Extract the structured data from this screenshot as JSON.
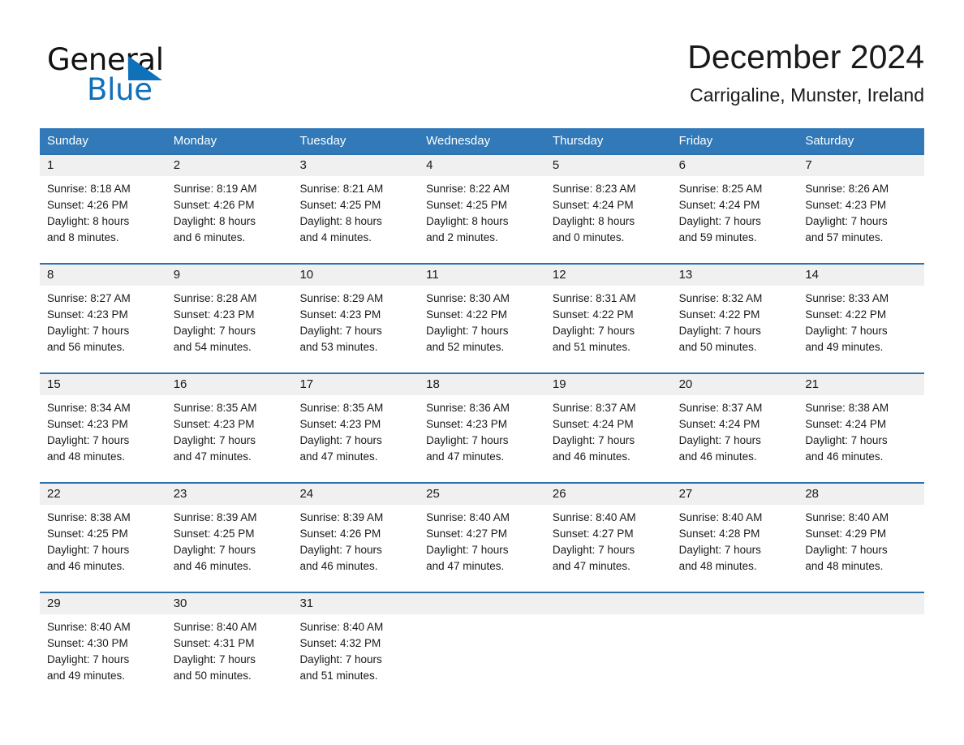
{
  "brand": {
    "name_top": "General",
    "name_bottom": "Blue",
    "color_black": "#111111",
    "color_blue": "#1071bb"
  },
  "header": {
    "month_title": "December 2024",
    "location": "Carrigaline, Munster, Ireland"
  },
  "theme": {
    "header_blue": "#3179b8",
    "separator_blue": "#2e72ac",
    "date_band_gray": "#f0f0f0",
    "text_dark": "#1a1a1a"
  },
  "weekday_headers": [
    "Sunday",
    "Monday",
    "Tuesday",
    "Wednesday",
    "Thursday",
    "Friday",
    "Saturday"
  ],
  "weeks": [
    [
      {
        "day": "1",
        "sunrise": "Sunrise: 8:18 AM",
        "sunset": "Sunset: 4:26 PM",
        "daylight1": "Daylight: 8 hours",
        "daylight2": "and 8 minutes."
      },
      {
        "day": "2",
        "sunrise": "Sunrise: 8:19 AM",
        "sunset": "Sunset: 4:26 PM",
        "daylight1": "Daylight: 8 hours",
        "daylight2": "and 6 minutes."
      },
      {
        "day": "3",
        "sunrise": "Sunrise: 8:21 AM",
        "sunset": "Sunset: 4:25 PM",
        "daylight1": "Daylight: 8 hours",
        "daylight2": "and 4 minutes."
      },
      {
        "day": "4",
        "sunrise": "Sunrise: 8:22 AM",
        "sunset": "Sunset: 4:25 PM",
        "daylight1": "Daylight: 8 hours",
        "daylight2": "and 2 minutes."
      },
      {
        "day": "5",
        "sunrise": "Sunrise: 8:23 AM",
        "sunset": "Sunset: 4:24 PM",
        "daylight1": "Daylight: 8 hours",
        "daylight2": "and 0 minutes."
      },
      {
        "day": "6",
        "sunrise": "Sunrise: 8:25 AM",
        "sunset": "Sunset: 4:24 PM",
        "daylight1": "Daylight: 7 hours",
        "daylight2": "and 59 minutes."
      },
      {
        "day": "7",
        "sunrise": "Sunrise: 8:26 AM",
        "sunset": "Sunset: 4:23 PM",
        "daylight1": "Daylight: 7 hours",
        "daylight2": "and 57 minutes."
      }
    ],
    [
      {
        "day": "8",
        "sunrise": "Sunrise: 8:27 AM",
        "sunset": "Sunset: 4:23 PM",
        "daylight1": "Daylight: 7 hours",
        "daylight2": "and 56 minutes."
      },
      {
        "day": "9",
        "sunrise": "Sunrise: 8:28 AM",
        "sunset": "Sunset: 4:23 PM",
        "daylight1": "Daylight: 7 hours",
        "daylight2": "and 54 minutes."
      },
      {
        "day": "10",
        "sunrise": "Sunrise: 8:29 AM",
        "sunset": "Sunset: 4:23 PM",
        "daylight1": "Daylight: 7 hours",
        "daylight2": "and 53 minutes."
      },
      {
        "day": "11",
        "sunrise": "Sunrise: 8:30 AM",
        "sunset": "Sunset: 4:22 PM",
        "daylight1": "Daylight: 7 hours",
        "daylight2": "and 52 minutes."
      },
      {
        "day": "12",
        "sunrise": "Sunrise: 8:31 AM",
        "sunset": "Sunset: 4:22 PM",
        "daylight1": "Daylight: 7 hours",
        "daylight2": "and 51 minutes."
      },
      {
        "day": "13",
        "sunrise": "Sunrise: 8:32 AM",
        "sunset": "Sunset: 4:22 PM",
        "daylight1": "Daylight: 7 hours",
        "daylight2": "and 50 minutes."
      },
      {
        "day": "14",
        "sunrise": "Sunrise: 8:33 AM",
        "sunset": "Sunset: 4:22 PM",
        "daylight1": "Daylight: 7 hours",
        "daylight2": "and 49 minutes."
      }
    ],
    [
      {
        "day": "15",
        "sunrise": "Sunrise: 8:34 AM",
        "sunset": "Sunset: 4:23 PM",
        "daylight1": "Daylight: 7 hours",
        "daylight2": "and 48 minutes."
      },
      {
        "day": "16",
        "sunrise": "Sunrise: 8:35 AM",
        "sunset": "Sunset: 4:23 PM",
        "daylight1": "Daylight: 7 hours",
        "daylight2": "and 47 minutes."
      },
      {
        "day": "17",
        "sunrise": "Sunrise: 8:35 AM",
        "sunset": "Sunset: 4:23 PM",
        "daylight1": "Daylight: 7 hours",
        "daylight2": "and 47 minutes."
      },
      {
        "day": "18",
        "sunrise": "Sunrise: 8:36 AM",
        "sunset": "Sunset: 4:23 PM",
        "daylight1": "Daylight: 7 hours",
        "daylight2": "and 47 minutes."
      },
      {
        "day": "19",
        "sunrise": "Sunrise: 8:37 AM",
        "sunset": "Sunset: 4:24 PM",
        "daylight1": "Daylight: 7 hours",
        "daylight2": "and 46 minutes."
      },
      {
        "day": "20",
        "sunrise": "Sunrise: 8:37 AM",
        "sunset": "Sunset: 4:24 PM",
        "daylight1": "Daylight: 7 hours",
        "daylight2": "and 46 minutes."
      },
      {
        "day": "21",
        "sunrise": "Sunrise: 8:38 AM",
        "sunset": "Sunset: 4:24 PM",
        "daylight1": "Daylight: 7 hours",
        "daylight2": "and 46 minutes."
      }
    ],
    [
      {
        "day": "22",
        "sunrise": "Sunrise: 8:38 AM",
        "sunset": "Sunset: 4:25 PM",
        "daylight1": "Daylight: 7 hours",
        "daylight2": "and 46 minutes."
      },
      {
        "day": "23",
        "sunrise": "Sunrise: 8:39 AM",
        "sunset": "Sunset: 4:25 PM",
        "daylight1": "Daylight: 7 hours",
        "daylight2": "and 46 minutes."
      },
      {
        "day": "24",
        "sunrise": "Sunrise: 8:39 AM",
        "sunset": "Sunset: 4:26 PM",
        "daylight1": "Daylight: 7 hours",
        "daylight2": "and 46 minutes."
      },
      {
        "day": "25",
        "sunrise": "Sunrise: 8:40 AM",
        "sunset": "Sunset: 4:27 PM",
        "daylight1": "Daylight: 7 hours",
        "daylight2": "and 47 minutes."
      },
      {
        "day": "26",
        "sunrise": "Sunrise: 8:40 AM",
        "sunset": "Sunset: 4:27 PM",
        "daylight1": "Daylight: 7 hours",
        "daylight2": "and 47 minutes."
      },
      {
        "day": "27",
        "sunrise": "Sunrise: 8:40 AM",
        "sunset": "Sunset: 4:28 PM",
        "daylight1": "Daylight: 7 hours",
        "daylight2": "and 48 minutes."
      },
      {
        "day": "28",
        "sunrise": "Sunrise: 8:40 AM",
        "sunset": "Sunset: 4:29 PM",
        "daylight1": "Daylight: 7 hours",
        "daylight2": "and 48 minutes."
      }
    ],
    [
      {
        "day": "29",
        "sunrise": "Sunrise: 8:40 AM",
        "sunset": "Sunset: 4:30 PM",
        "daylight1": "Daylight: 7 hours",
        "daylight2": "and 49 minutes."
      },
      {
        "day": "30",
        "sunrise": "Sunrise: 8:40 AM",
        "sunset": "Sunset: 4:31 PM",
        "daylight1": "Daylight: 7 hours",
        "daylight2": "and 50 minutes."
      },
      {
        "day": "31",
        "sunrise": "Sunrise: 8:40 AM",
        "sunset": "Sunset: 4:32 PM",
        "daylight1": "Daylight: 7 hours",
        "daylight2": "and 51 minutes."
      },
      {
        "day": "",
        "sunrise": "",
        "sunset": "",
        "daylight1": "",
        "daylight2": ""
      },
      {
        "day": "",
        "sunrise": "",
        "sunset": "",
        "daylight1": "",
        "daylight2": ""
      },
      {
        "day": "",
        "sunrise": "",
        "sunset": "",
        "daylight1": "",
        "daylight2": ""
      },
      {
        "day": "",
        "sunrise": "",
        "sunset": "",
        "daylight1": "",
        "daylight2": ""
      }
    ]
  ]
}
